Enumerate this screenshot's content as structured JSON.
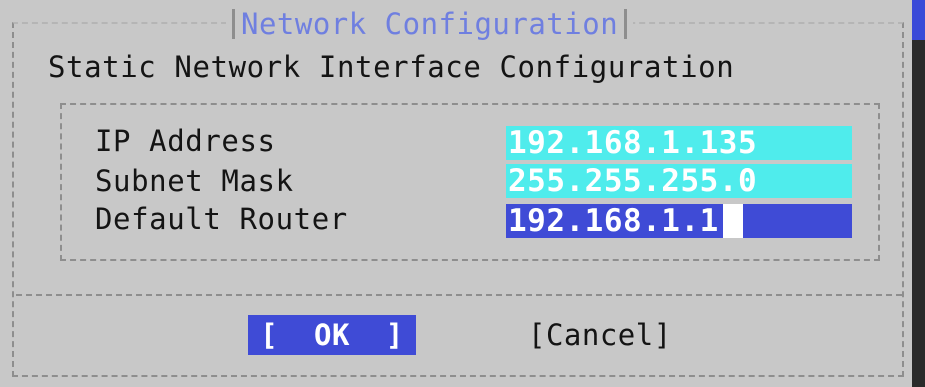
{
  "dialog": {
    "title": "Network Configuration",
    "subtitle": "Static Network Interface Configuration"
  },
  "fields": [
    {
      "label": "IP Address",
      "value": "192.168.1.135",
      "focused": false
    },
    {
      "label": "Subnet Mask",
      "value": "255.255.255.0",
      "focused": false
    },
    {
      "label": "Default Router",
      "value": "192.168.1.1",
      "focused": true
    }
  ],
  "buttons": {
    "ok_label": "[  OK  ]",
    "cancel_label": "[Cancel]"
  },
  "colors": {
    "dialog_background": "#c8c8c8",
    "title_text": "#6f7fe0",
    "input_unfocused": "#4fecec",
    "input_focused": "#3f4bd6",
    "screen_background": "#3a4ad8"
  }
}
